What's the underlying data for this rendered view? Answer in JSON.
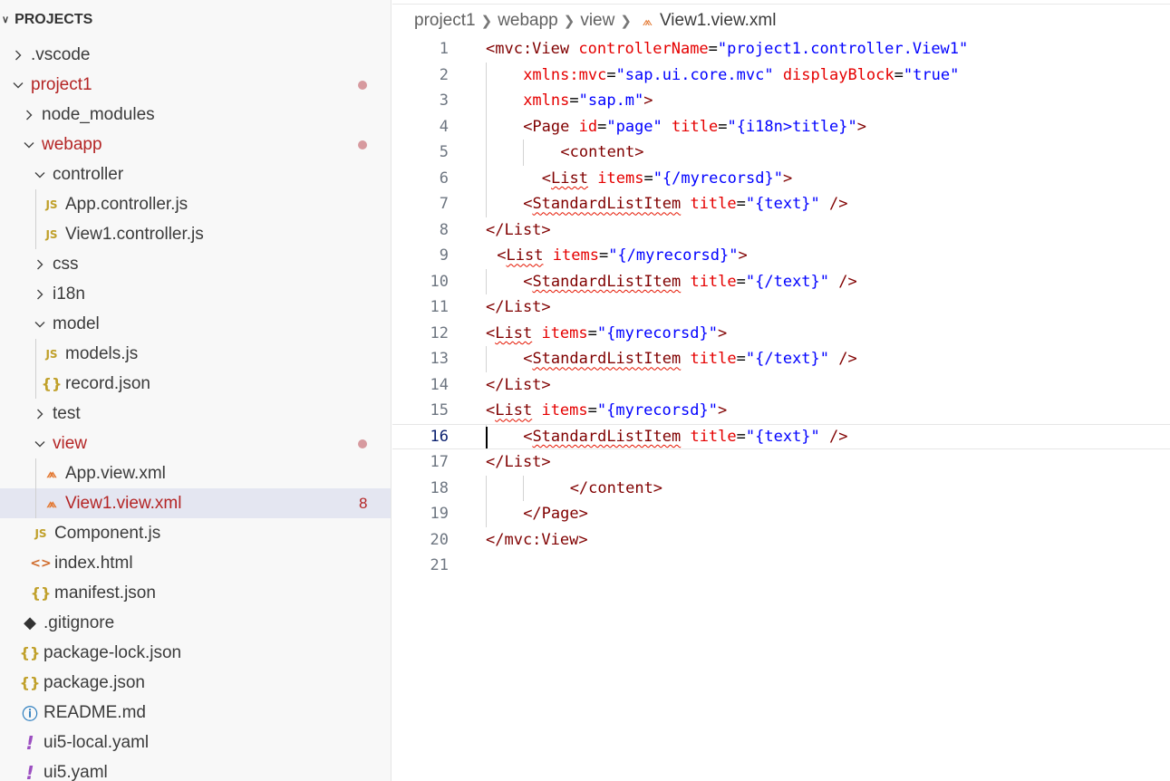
{
  "sidebar": {
    "title": "PROJECTS",
    "items": [
      {
        "label": ".vscode",
        "icon": "chevron-right-icon",
        "depth": 0,
        "kind": "folder",
        "expanded": false
      },
      {
        "label": "project1",
        "icon": "chevron-down-icon",
        "depth": 0,
        "kind": "folder",
        "expanded": true,
        "modified": true
      },
      {
        "label": "node_modules",
        "depth": 1,
        "kind": "folder",
        "expanded": false
      },
      {
        "label": "webapp",
        "depth": 1,
        "kind": "folder",
        "expanded": true,
        "modified": true
      },
      {
        "label": "controller",
        "depth": 2,
        "kind": "folder",
        "expanded": true
      },
      {
        "label": "App.controller.js",
        "depth": 3,
        "kind": "file",
        "icon": "js-file-icon",
        "icon_text": "JS"
      },
      {
        "label": "View1.controller.js",
        "depth": 3,
        "kind": "file",
        "icon": "js-file-icon",
        "icon_text": "JS"
      },
      {
        "label": "css",
        "depth": 2,
        "kind": "folder",
        "expanded": false
      },
      {
        "label": "i18n",
        "depth": 2,
        "kind": "folder",
        "expanded": false
      },
      {
        "label": "model",
        "depth": 2,
        "kind": "folder",
        "expanded": true
      },
      {
        "label": "models.js",
        "depth": 3,
        "kind": "file",
        "icon": "js-file-icon",
        "icon_text": "JS"
      },
      {
        "label": "record.json",
        "depth": 3,
        "kind": "file",
        "icon": "json-file-icon",
        "icon_text": "{}"
      },
      {
        "label": "test",
        "depth": 2,
        "kind": "folder",
        "expanded": false
      },
      {
        "label": "view",
        "depth": 2,
        "kind": "folder",
        "expanded": true,
        "modified": true
      },
      {
        "label": "App.view.xml",
        "depth": 3,
        "kind": "file",
        "icon": "xml-file-icon",
        "icon_text": "⩕"
      },
      {
        "label": "View1.view.xml",
        "depth": 3,
        "kind": "file",
        "icon": "xml-file-icon",
        "icon_text": "⩕",
        "selected": true,
        "modified": true,
        "problems": "8"
      },
      {
        "label": "Component.js",
        "depth": 2,
        "kind": "file",
        "icon": "js-file-icon",
        "icon_text": "JS"
      },
      {
        "label": "index.html",
        "depth": 2,
        "kind": "file",
        "icon": "html-file-icon",
        "icon_text": "<>"
      },
      {
        "label": "manifest.json",
        "depth": 2,
        "kind": "file",
        "icon": "json-file-icon",
        "icon_text": "{}"
      },
      {
        "label": ".gitignore",
        "depth": 1,
        "kind": "file",
        "icon": "git-file-icon",
        "icon_text": "◆"
      },
      {
        "label": "package-lock.json",
        "depth": 1,
        "kind": "file",
        "icon": "json-file-icon",
        "icon_text": "{}"
      },
      {
        "label": "package.json",
        "depth": 1,
        "kind": "file",
        "icon": "json-file-icon",
        "icon_text": "{}"
      },
      {
        "label": "README.md",
        "depth": 1,
        "kind": "file",
        "icon": "info-file-icon",
        "icon_text": "ⓘ"
      },
      {
        "label": "ui5-local.yaml",
        "depth": 1,
        "kind": "file",
        "icon": "yaml-file-icon",
        "icon_text": "!"
      },
      {
        "label": "ui5.yaml",
        "depth": 1,
        "kind": "file",
        "icon": "yaml-file-icon",
        "icon_text": "!"
      }
    ]
  },
  "breadcrumb": {
    "parts": [
      "project1",
      "webapp",
      "view"
    ],
    "file": "View1.view.xml"
  },
  "editor": {
    "current_line": 16,
    "lines": [
      {
        "n": "1",
        "indent": 0,
        "tokens": [
          [
            "t-tag",
            "<mvc:View"
          ],
          [
            "t-plain",
            " "
          ],
          [
            "t-attr",
            "controllerName"
          ],
          [
            "t-eq",
            "="
          ],
          [
            "t-str",
            "\"project1.controller.View1\""
          ]
        ]
      },
      {
        "n": "2",
        "indent": 4,
        "tokens": [
          [
            "t-attr",
            "xmlns:mvc"
          ],
          [
            "t-eq",
            "="
          ],
          [
            "t-str",
            "\"sap.ui.core.mvc\""
          ],
          [
            "t-plain",
            " "
          ],
          [
            "t-attr",
            "displayBlock"
          ],
          [
            "t-eq",
            "="
          ],
          [
            "t-str",
            "\"true\""
          ]
        ]
      },
      {
        "n": "3",
        "indent": 4,
        "tokens": [
          [
            "t-attr",
            "xmlns"
          ],
          [
            "t-eq",
            "="
          ],
          [
            "t-str",
            "\"sap.m\""
          ],
          [
            "t-tag",
            ">"
          ]
        ]
      },
      {
        "n": "4",
        "indent": 4,
        "tokens": [
          [
            "t-tag",
            "<Page"
          ],
          [
            "t-plain",
            " "
          ],
          [
            "t-attr",
            "id"
          ],
          [
            "t-eq",
            "="
          ],
          [
            "t-str",
            "\"page\""
          ],
          [
            "t-plain",
            " "
          ],
          [
            "t-attr",
            "title"
          ],
          [
            "t-eq",
            "="
          ],
          [
            "t-str",
            "\"{i18n>title}\""
          ],
          [
            "t-tag",
            ">"
          ]
        ]
      },
      {
        "n": "5",
        "indent": 8,
        "tokens": [
          [
            "t-tag",
            "<content>"
          ]
        ]
      },
      {
        "n": "6",
        "indent": 6,
        "tokens": [
          [
            "t-tag",
            "<"
          ],
          [
            "t-tag squig",
            "List"
          ],
          [
            "t-plain",
            " "
          ],
          [
            "t-attr",
            "items"
          ],
          [
            "t-eq",
            "="
          ],
          [
            "t-str",
            "\"{/myrecorsd}\""
          ],
          [
            "t-tag",
            ">"
          ]
        ]
      },
      {
        "n": "7",
        "indent": 4,
        "tokens": [
          [
            "t-tag",
            "<"
          ],
          [
            "t-tag squig",
            "StandardListItem"
          ],
          [
            "t-plain",
            " "
          ],
          [
            "t-attr",
            "title"
          ],
          [
            "t-eq",
            "="
          ],
          [
            "t-str",
            "\"{text}\""
          ],
          [
            "t-plain",
            " "
          ],
          [
            "t-tag",
            "/>"
          ]
        ]
      },
      {
        "n": "8",
        "indent": 0,
        "tokens": [
          [
            "t-tag",
            "</List>"
          ]
        ]
      },
      {
        "n": "9",
        "indent": 1,
        "tokens": [
          [
            "t-tag",
            "<"
          ],
          [
            "t-tag squig",
            "List"
          ],
          [
            "t-plain",
            " "
          ],
          [
            "t-attr",
            "items"
          ],
          [
            "t-eq",
            "="
          ],
          [
            "t-str",
            "\"{/myrecorsd}\""
          ],
          [
            "t-tag",
            ">"
          ]
        ]
      },
      {
        "n": "10",
        "indent": 4,
        "tokens": [
          [
            "t-tag",
            "<"
          ],
          [
            "t-tag squig",
            "StandardListItem"
          ],
          [
            "t-plain",
            " "
          ],
          [
            "t-attr",
            "title"
          ],
          [
            "t-eq",
            "="
          ],
          [
            "t-str",
            "\"{/text}\""
          ],
          [
            "t-plain",
            " "
          ],
          [
            "t-tag",
            "/>"
          ]
        ]
      },
      {
        "n": "11",
        "indent": 0,
        "tokens": [
          [
            "t-tag",
            "</List>"
          ]
        ]
      },
      {
        "n": "12",
        "indent": 0,
        "tokens": [
          [
            "t-tag",
            "<"
          ],
          [
            "t-tag squig",
            "List"
          ],
          [
            "t-plain",
            " "
          ],
          [
            "t-attr",
            "items"
          ],
          [
            "t-eq",
            "="
          ],
          [
            "t-str",
            "\"{myrecorsd}\""
          ],
          [
            "t-tag",
            ">"
          ]
        ]
      },
      {
        "n": "13",
        "indent": 4,
        "tokens": [
          [
            "t-tag",
            "<"
          ],
          [
            "t-tag squig",
            "StandardListItem"
          ],
          [
            "t-plain",
            " "
          ],
          [
            "t-attr",
            "title"
          ],
          [
            "t-eq",
            "="
          ],
          [
            "t-str",
            "\"{/text}\""
          ],
          [
            "t-plain",
            " "
          ],
          [
            "t-tag",
            "/>"
          ]
        ]
      },
      {
        "n": "14",
        "indent": 0,
        "tokens": [
          [
            "t-tag",
            "</List>"
          ]
        ]
      },
      {
        "n": "15",
        "indent": 0,
        "tokens": [
          [
            "t-tag",
            "<"
          ],
          [
            "t-tag squig",
            "List"
          ],
          [
            "t-plain",
            " "
          ],
          [
            "t-attr",
            "items"
          ],
          [
            "t-eq",
            "="
          ],
          [
            "t-str",
            "\"{myrecorsd}\""
          ],
          [
            "t-tag",
            ">"
          ]
        ]
      },
      {
        "n": "16",
        "indent": 4,
        "tokens": [
          [
            "t-tag",
            "<"
          ],
          [
            "t-tag squig",
            "StandardListItem"
          ],
          [
            "t-plain",
            " "
          ],
          [
            "t-attr",
            "title"
          ],
          [
            "t-eq",
            "="
          ],
          [
            "t-str",
            "\"{text}\""
          ],
          [
            "t-plain",
            " "
          ],
          [
            "t-tag",
            "/>"
          ]
        ]
      },
      {
        "n": "17",
        "indent": 0,
        "tokens": [
          [
            "t-tag",
            "</List>"
          ]
        ]
      },
      {
        "n": "18",
        "indent": 9,
        "tokens": [
          [
            "t-tag",
            "</content>"
          ]
        ]
      },
      {
        "n": "19",
        "indent": 4,
        "tokens": [
          [
            "t-tag",
            "</Page>"
          ]
        ]
      },
      {
        "n": "20",
        "indent": 0,
        "tokens": [
          [
            "t-tag",
            "</mvc:View>"
          ]
        ]
      },
      {
        "n": "21",
        "indent": 0,
        "tokens": []
      }
    ]
  },
  "colors": {
    "modified": "#b42525",
    "modified_dot": "#d79a9f",
    "selected_row": "#e4e6f1",
    "tag": "#800000",
    "attribute": "#e50000",
    "string": "#0000ff"
  }
}
